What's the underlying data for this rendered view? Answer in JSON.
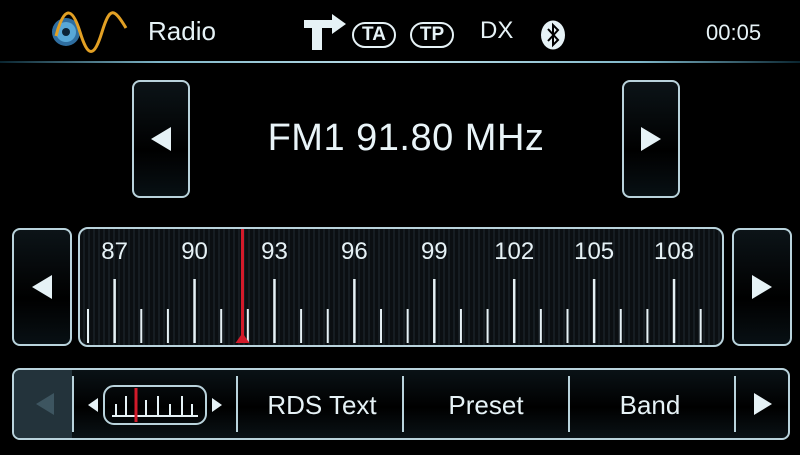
{
  "header": {
    "title": "Radio",
    "app_icon": "radio-wave-disc-icon",
    "nav_icon": "navigation-turn-icon",
    "ta_label": "TA",
    "tp_label": "TP",
    "dx_label": "DX",
    "bluetooth_icon": "bluetooth-icon",
    "clock": "00:05"
  },
  "station": {
    "band": "FM1",
    "frequency": "91.80",
    "unit": "MHz",
    "display": "FM1 91.80 MHz"
  },
  "scale": {
    "min_mhz": 86,
    "max_mhz": 109.5,
    "labels": [
      "87",
      "90",
      "93",
      "96",
      "99",
      "102",
      "105",
      "108"
    ],
    "current_mhz": 91.8,
    "needle_color": "#d21a2a"
  },
  "bottom_bar": {
    "rds_label": "RDS Text",
    "preset_label": "Preset",
    "band_label": "Band"
  },
  "colors": {
    "accent": "#b9d3dc",
    "text": "#e6f2f6",
    "needle": "#d21a2a"
  }
}
